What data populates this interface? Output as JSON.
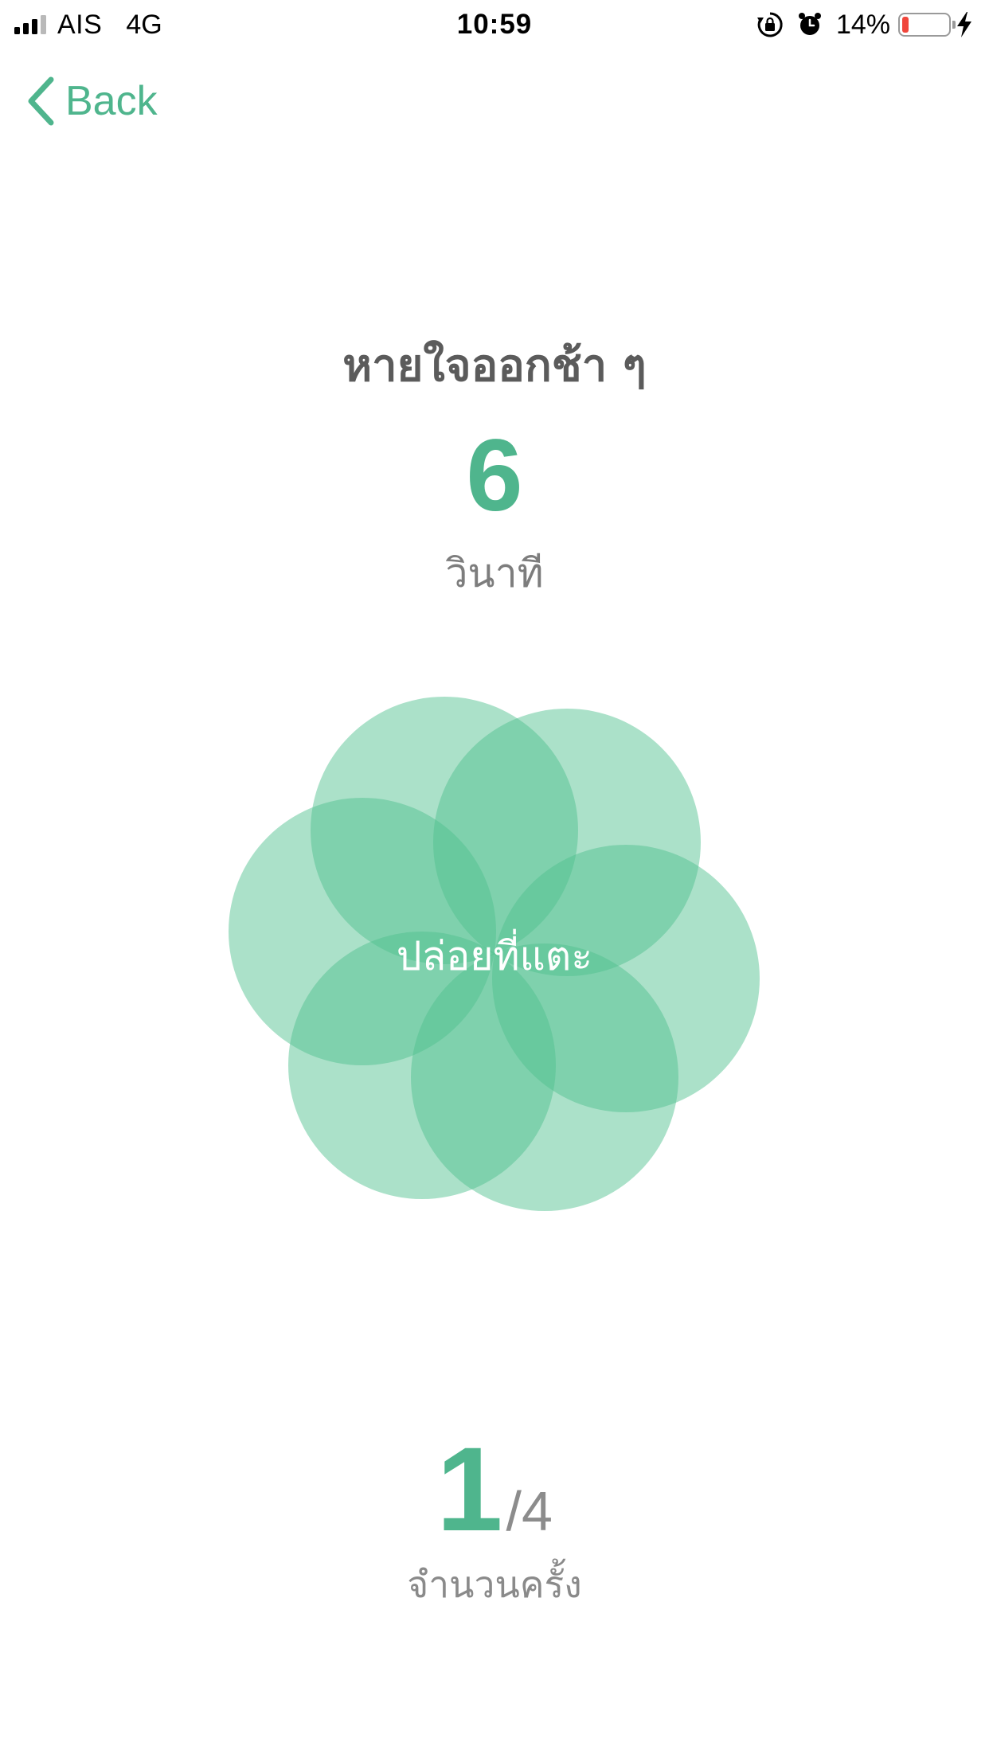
{
  "status_bar": {
    "carrier": "AIS",
    "network": "4G",
    "time": "10:59",
    "battery_percent_text": "14%",
    "battery_level": 0.14,
    "icons": [
      "signal-icon",
      "rotation-lock-icon",
      "alarm-icon",
      "battery-icon",
      "charging-bolt-icon"
    ]
  },
  "nav": {
    "back_label": "Back"
  },
  "breathing": {
    "instruction": "หายใจออกช้า ๆ",
    "seconds_value": "6",
    "seconds_unit": "วินาที",
    "flower_label": "ปล่อยที่แตะ"
  },
  "counter": {
    "current": "1",
    "total": "/4",
    "caption": "จำนวนครั้ง"
  },
  "colors": {
    "accent": "#4fb58d",
    "petal": "#4fc08e",
    "text_dark": "#5b5b5b",
    "text_muted": "#8a8a8a",
    "battery_low": "#f0463c"
  }
}
